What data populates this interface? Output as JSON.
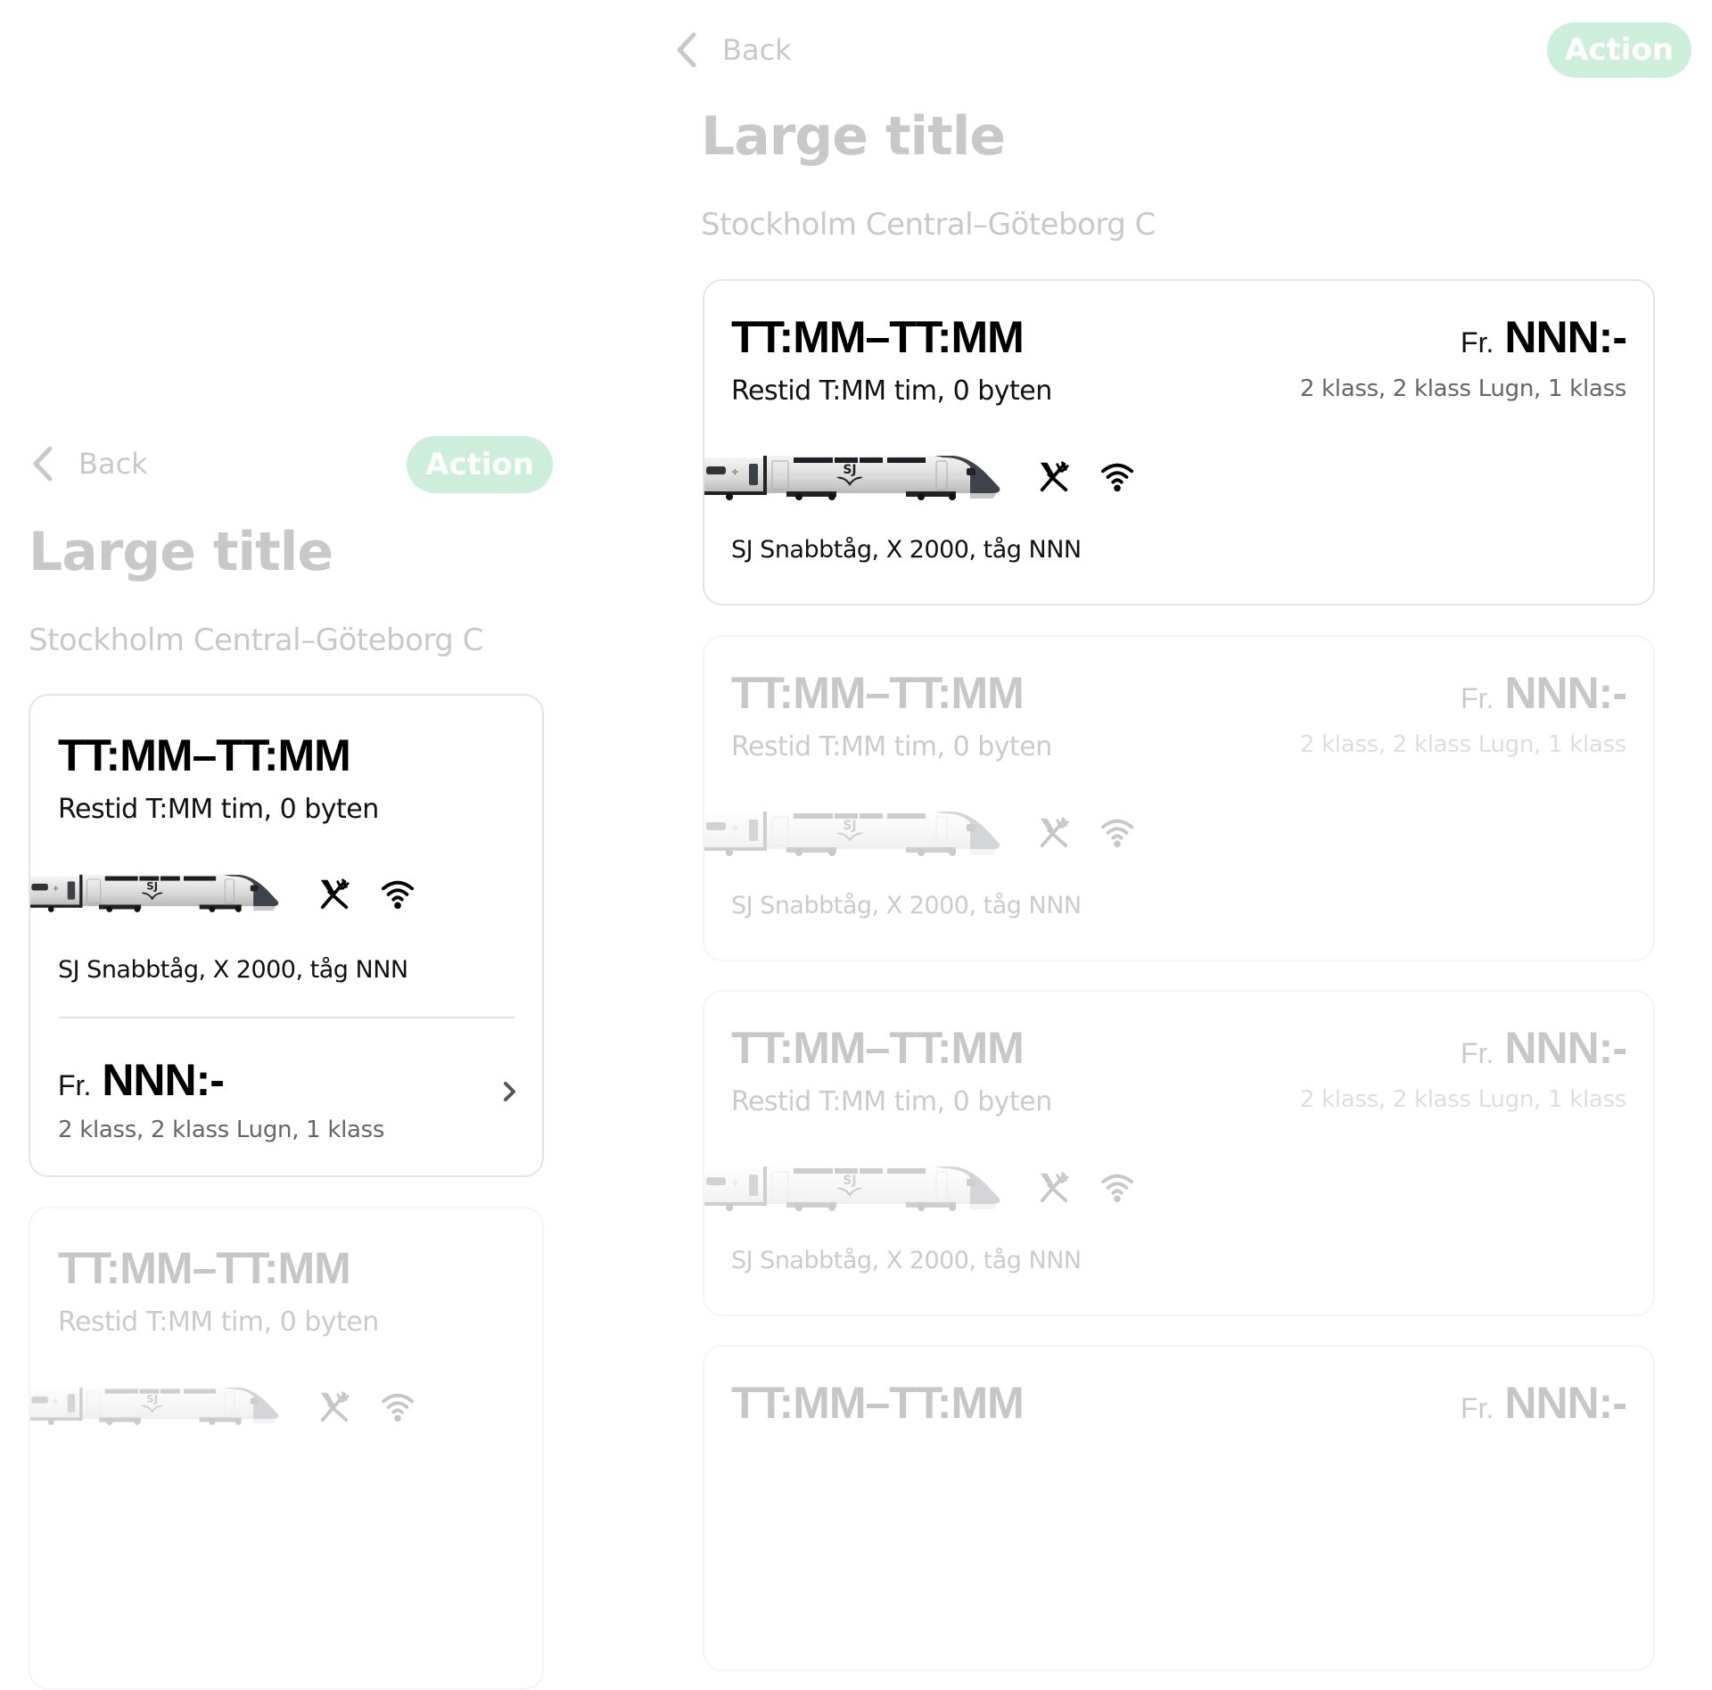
{
  "colors": {
    "action_bg": "#cdeedb",
    "action_text": "#ffffff",
    "muted_text": "#c8c8c8",
    "card_border": "#e4e4e4",
    "secondary_text": "#666666"
  },
  "nav": {
    "back_icon": "chevron-left-icon",
    "back_label": "Back",
    "action_label": "Action"
  },
  "header": {
    "title": "Large title",
    "route": "Stockholm Central–Göteborg C"
  },
  "departure": {
    "times": "TT:MM–TT:MM",
    "duration": "Restid T:MM tim, 0 byten",
    "train_info": "SJ Snabbtåg, X 2000, tåg NNN",
    "price_prefix": "Fr.",
    "price": "NNN:-",
    "classes": "2 klass, 2 klass Lugn, 1 klass",
    "train_logo": "SJ",
    "amenities": [
      "restaurant-icon",
      "wifi-icon"
    ]
  },
  "layouts": {
    "compact": {
      "name": "Mobile layout",
      "cards_visible": 2
    },
    "wide": {
      "name": "Tablet layout",
      "cards_visible": 4
    }
  }
}
